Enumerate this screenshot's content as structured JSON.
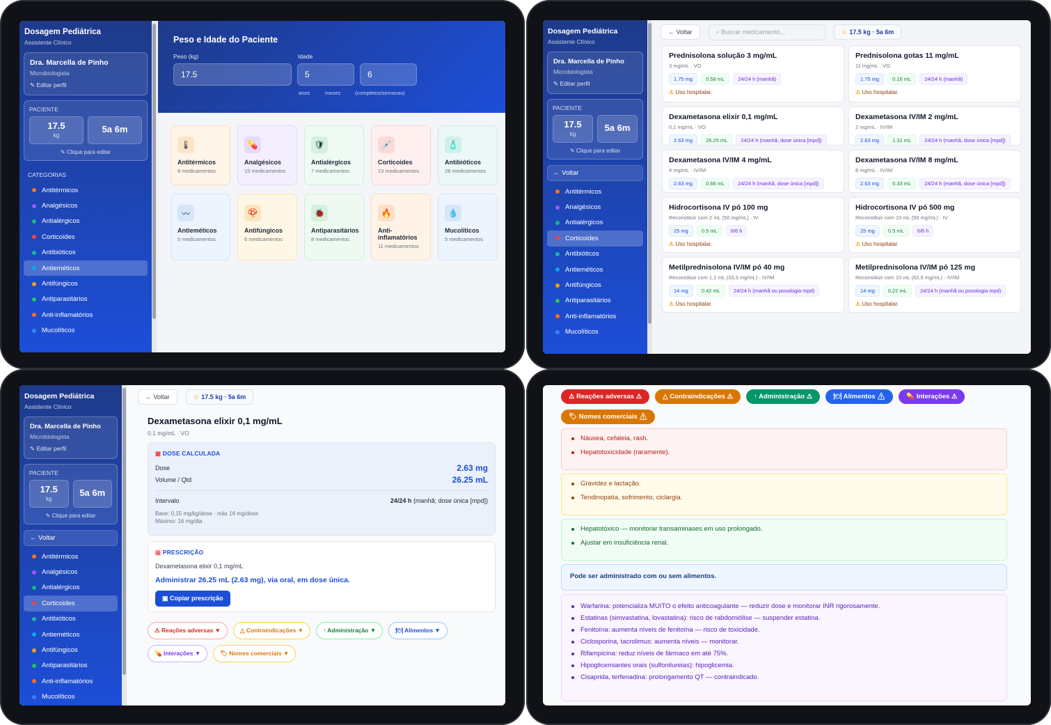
{
  "app": {
    "title": "Dosagem Pediátrica",
    "subtitle": "Assistente Clínico"
  },
  "doctor": {
    "name": "Dra. Marcella de Pinho",
    "specialty": "Microbiologista",
    "edit": "Editar perfil",
    "edit_icon": "pencil-icon"
  },
  "patient": {
    "label": "PACIENTE",
    "weight": "17.5",
    "weight_unit": "kg",
    "age": "5a 6m",
    "click_edit": "Clique para editar"
  },
  "nav": {
    "back": "← Voltar",
    "categories_title": "CATEGORIAS"
  },
  "categories": [
    {
      "name": "Antitérmicos",
      "count": "8 medicamentos",
      "dot": "#f97316",
      "bg": "#fff4e8",
      "border": "#fddcb5",
      "iconbg": "#fde4c8",
      "icon": "thermometer-icon",
      "glyph": "🌡"
    },
    {
      "name": "Analgésicos",
      "count": "15 medicamentos",
      "dot": "#a855f7",
      "bg": "#f4efff",
      "border": "#e2d6fb",
      "iconbg": "#e6dafb",
      "icon": "pill-icon",
      "glyph": "💊"
    },
    {
      "name": "Antialérgicos",
      "count": "7 medicamentos",
      "dot": "#10b981",
      "bg": "#eefaf3",
      "border": "#cdeedb",
      "iconbg": "#d2f1df",
      "icon": "shield-icon",
      "glyph": "🛡"
    },
    {
      "name": "Corticoides",
      "count": "13 medicamentos",
      "dot": "#ef4444",
      "bg": "#fff0f0",
      "border": "#f9d3d3",
      "iconbg": "#fbd9d9",
      "icon": "syringe-icon",
      "glyph": "💉"
    },
    {
      "name": "Antibióticos",
      "count": "28 medicamentos",
      "dot": "#14b8a6",
      "bg": "#ecf8f6",
      "border": "#cbebe6",
      "iconbg": "#d0efea",
      "icon": "bottle-icon",
      "glyph": "🧴"
    },
    {
      "name": "Antieméticos",
      "count": "5 medicamentos",
      "dot": "#0ea5e9",
      "bg": "#edf4fd",
      "border": "#d3e3f8",
      "iconbg": "#d6e6fa",
      "icon": "wave-icon",
      "glyph": "〰"
    },
    {
      "name": "Antifúngicos",
      "count": "6 medicamentos",
      "dot": "#f59e0b",
      "bg": "#fff7e6",
      "border": "#fbe3b4",
      "iconbg": "#fbe6bf",
      "icon": "fungus-icon",
      "glyph": "🍄"
    },
    {
      "name": "Antiparasitários",
      "count": "8 medicamentos",
      "dot": "#22c55e",
      "bg": "#eefaf1",
      "border": "#d0eed8",
      "iconbg": "#d3f1dc",
      "icon": "bug-icon",
      "glyph": "🐞"
    },
    {
      "name": "Anti-inflamatórios",
      "count": "11 medicamentos",
      "dot": "#f97316",
      "bg": "#fff3e8",
      "border": "#fcdcbc",
      "iconbg": "#fde1c6",
      "icon": "flame-icon",
      "glyph": "🔥"
    },
    {
      "name": "Mucolíticos",
      "count": "5 medicamentos",
      "dot": "#3b82f6",
      "bg": "#eef4fd",
      "border": "#d5e3f7",
      "iconbg": "#d8e6f9",
      "icon": "drop-icon",
      "glyph": "💧"
    }
  ],
  "patient_form": {
    "title": "Peso e Idade do Paciente",
    "weight_label": "Peso (kg)",
    "age_label": "Idade",
    "weight": "17.5",
    "years": "5",
    "months": "6",
    "years_hint": "anos",
    "months_hint": "meses",
    "hint_extra": "(completos/semanas)"
  },
  "search": {
    "placeholder": "Buscar medicamento...",
    "patient_chip": "17.5 kg · 5a 6m"
  },
  "medications": [
    {
      "name": "Prednisolona solução 3 mg/mL",
      "sub": "3 mg/mL · VO",
      "dose": "1.75 mg",
      "vol": "0.58 mL",
      "interval": "24/24 h (manhã)",
      "warn": "Uso hospitalar."
    },
    {
      "name": "Prednisolona gotas 11 mg/mL",
      "sub": "11 mg/mL · VO",
      "dose": "1.75 mg",
      "vol": "0.16 mL",
      "interval": "24/24 h (manhã)",
      "warn": "Uso hospitalar."
    },
    {
      "name": "Dexametasona elixir 0,1 mg/mL",
      "sub": "0,1 mg/mL · VO",
      "dose": "2.63 mg",
      "vol": "26.25 mL",
      "interval": "24/24 h (manhã, dose única [mpd])",
      "warn": ""
    },
    {
      "name": "Dexametasona IV/IM 2 mg/mL",
      "sub": "2 mg/mL · IV/IM",
      "dose": "2.63 mg",
      "vol": "1.31 mL",
      "interval": "24/24 h (manhã, dose única [mpd])",
      "warn": ""
    },
    {
      "name": "Dexametasona IV/IM 4 mg/mL",
      "sub": "4 mg/mL · IV/IM",
      "dose": "2.63 mg",
      "vol": "0.66 mL",
      "interval": "24/24 h (manhã, dose única [mpd])",
      "warn": "Uso hospitalar."
    },
    {
      "name": "Dexametasona IV/IM 8 mg/mL",
      "sub": "8 mg/mL · IV/IM",
      "dose": "2.63 mg",
      "vol": "0.33 mL",
      "interval": "24/24 h (manhã, dose única [mpd])",
      "warn": "Uso hospitalar."
    },
    {
      "name": "Hidrocortisona IV pó 100 mg",
      "sub": "Reconstituir com 2 mL (50 mg/mL) · IV",
      "dose": "25 mg",
      "vol": "0.5 mL",
      "interval": "6/6 h",
      "warn": "Uso hospitalar."
    },
    {
      "name": "Hidrocortisona IV pó 500 mg",
      "sub": "Reconstituir com 10 mL (50 mg/mL) · IV",
      "dose": "25 mg",
      "vol": "0.5 mL",
      "interval": "6/6 h",
      "warn": "Uso hospitalar."
    },
    {
      "name": "Metilprednisolona IV/IM pó 40 mg",
      "sub": "Reconstituir com 1,2 mL (33,3 mg/mL) · IV/IM",
      "dose": "14 mg",
      "vol": "0.42 mL",
      "interval": "24/24 h (manhã ou posologia mpd)",
      "warn": "Uso hospitalar."
    },
    {
      "name": "Metilprednisolona IV/IM pó 125 mg",
      "sub": "Reconstituir com 10 mL (62,5 mg/mL) · IV/IM",
      "dose": "14 mg",
      "vol": "0.22 mL",
      "interval": "24/24 h (manhã ou posologia mpd)",
      "warn": "Uso hospitalar."
    }
  ],
  "detail": {
    "back": "← Voltar",
    "patient_chip": "17.5 kg · 5a 6m",
    "name": "Dexametasona elixir 0,1 mg/mL",
    "sub": "0,1 mg/mL · VO",
    "dose_title": "DOSE CALCULADA",
    "dose_label": "Dose",
    "dose_value": "2.63 mg",
    "vol_label": "Volume / Qtd",
    "vol_value": "26.25 mL",
    "interval_label": "Intervalo",
    "interval_bold": "24/24 h",
    "interval_rest": " (manhã; dose única [mpd])",
    "base": "Base: 0,15 mg/kg/dose · máx 16 mg/dose",
    "max": "Máximo: 16 mg/dia",
    "presc_title": "PRESCRIÇÃO",
    "presc_line": "Dexametasona elixir 0,1 mg/mL",
    "presc_main": "Administrar 26.25 mL (2.63 mg), via oral, em dose única.",
    "copy": "Copiar prescrição"
  },
  "info_tabs": [
    {
      "label": "Reações adversas",
      "color": "#dc2626",
      "border": "#fca5a5",
      "icon": "warning-icon",
      "glyph": "⚠"
    },
    {
      "label": "Contraindicações",
      "color": "#d97706",
      "border": "#fcd34d",
      "icon": "alert-triangle-icon",
      "glyph": "△"
    },
    {
      "label": "Administração",
      "color": "#15803d",
      "border": "#86efac",
      "icon": "arrow-up-icon",
      "glyph": "↑"
    },
    {
      "label": "Alimentos",
      "color": "#1d4ed8",
      "border": "#93c5fd",
      "icon": "food-icon",
      "glyph": "🍽"
    },
    {
      "label": "Interações",
      "color": "#7c3aed",
      "border": "#c4b5fd",
      "icon": "interaction-icon",
      "glyph": "💊"
    },
    {
      "label": "Nomes comerciais",
      "color": "#d97706",
      "border": "#fcd34d",
      "icon": "tag-icon",
      "glyph": "🏷"
    }
  ],
  "big_tabs": [
    {
      "label": "Reações adversas",
      "color": "#dc2626"
    },
    {
      "label": "Contraindicações",
      "color": "#d97706"
    },
    {
      "label": "Administração",
      "color": "#059669"
    },
    {
      "label": "Alimentos",
      "color": "#2563eb"
    },
    {
      "label": "Interações",
      "color": "#7c3aed"
    },
    {
      "label": "Nomes comerciais",
      "color": "#d97706"
    }
  ],
  "info": {
    "adverse": [
      "Náusea, cefaleia, rash.",
      "Hepatotoxicidade (raramente)."
    ],
    "contra": [
      "Gravidez e lactação.",
      "Tendinopatia, sofrimento, ciclargia."
    ],
    "admin": [
      "Hepatotóxico — monitorar transaminases em uso prolongado.",
      "Ajustar em insuficiência renal."
    ],
    "food": "Pode ser administrado com ou sem alimentos.",
    "interactions": [
      "Warfarina: potencializa MUITO o efeito anticoagulante — reduzir dose e monitorar INR rigorosamente.",
      "Estatinas (simvastatina, lovastatina): risco de rabdomiólise — suspender estatina.",
      "Fenitoína: aumenta níveis de fenitoína — risco de toxicidade.",
      "Ciclosporina, tacrolimus: aumenta níveis — monitorar.",
      "Rifampicina: reduz níveis de fármaco em até 75%.",
      "Hipoglicemiantes orais (sulfonilureias): hipoglicemia.",
      "Cisaprida, terfenadina: prolongamento QT — contraindicado."
    ]
  },
  "colors": {
    "sidebar": "#1e3a8a",
    "accent": "#1d4ed8",
    "active": "Corticoides"
  }
}
